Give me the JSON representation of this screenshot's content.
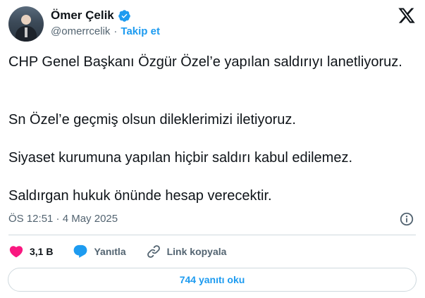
{
  "author": {
    "name": "Ömer Çelik",
    "handle": "@omerrcelik",
    "separator": "·",
    "follow_label": "Takip et"
  },
  "tweet": {
    "paragraph_1": "CHP Genel Başkanı Özgür Özel’e yapılan saldırıyı lanetliyoruz.",
    "paragraph_2": "Sn Özel’e geçmiş olsun dileklerimizi iletiyoruz.",
    "paragraph_3": "Siyaset kurumuna yapılan hiçbir saldırı kabul edilemez.",
    "paragraph_4": "Saldırgan hukuk önünde hesap verecektir.",
    "timestamp": "ÖS 12:51 · 4 May 2025"
  },
  "actions": {
    "like_count": "3,1 B",
    "reply_label": "Yanıtla",
    "copy_link_label": "Link kopyala"
  },
  "read_replies_label": "744 yanıtı oku",
  "colors": {
    "accent": "#1d9bf0",
    "like": "#f91880",
    "muted_text": "#536471",
    "text": "#0f1419",
    "border": "#cfd9de"
  },
  "icons": [
    "verified-badge-icon",
    "x-logo-icon",
    "info-icon",
    "heart-icon",
    "reply-bubble-icon",
    "link-icon"
  ]
}
